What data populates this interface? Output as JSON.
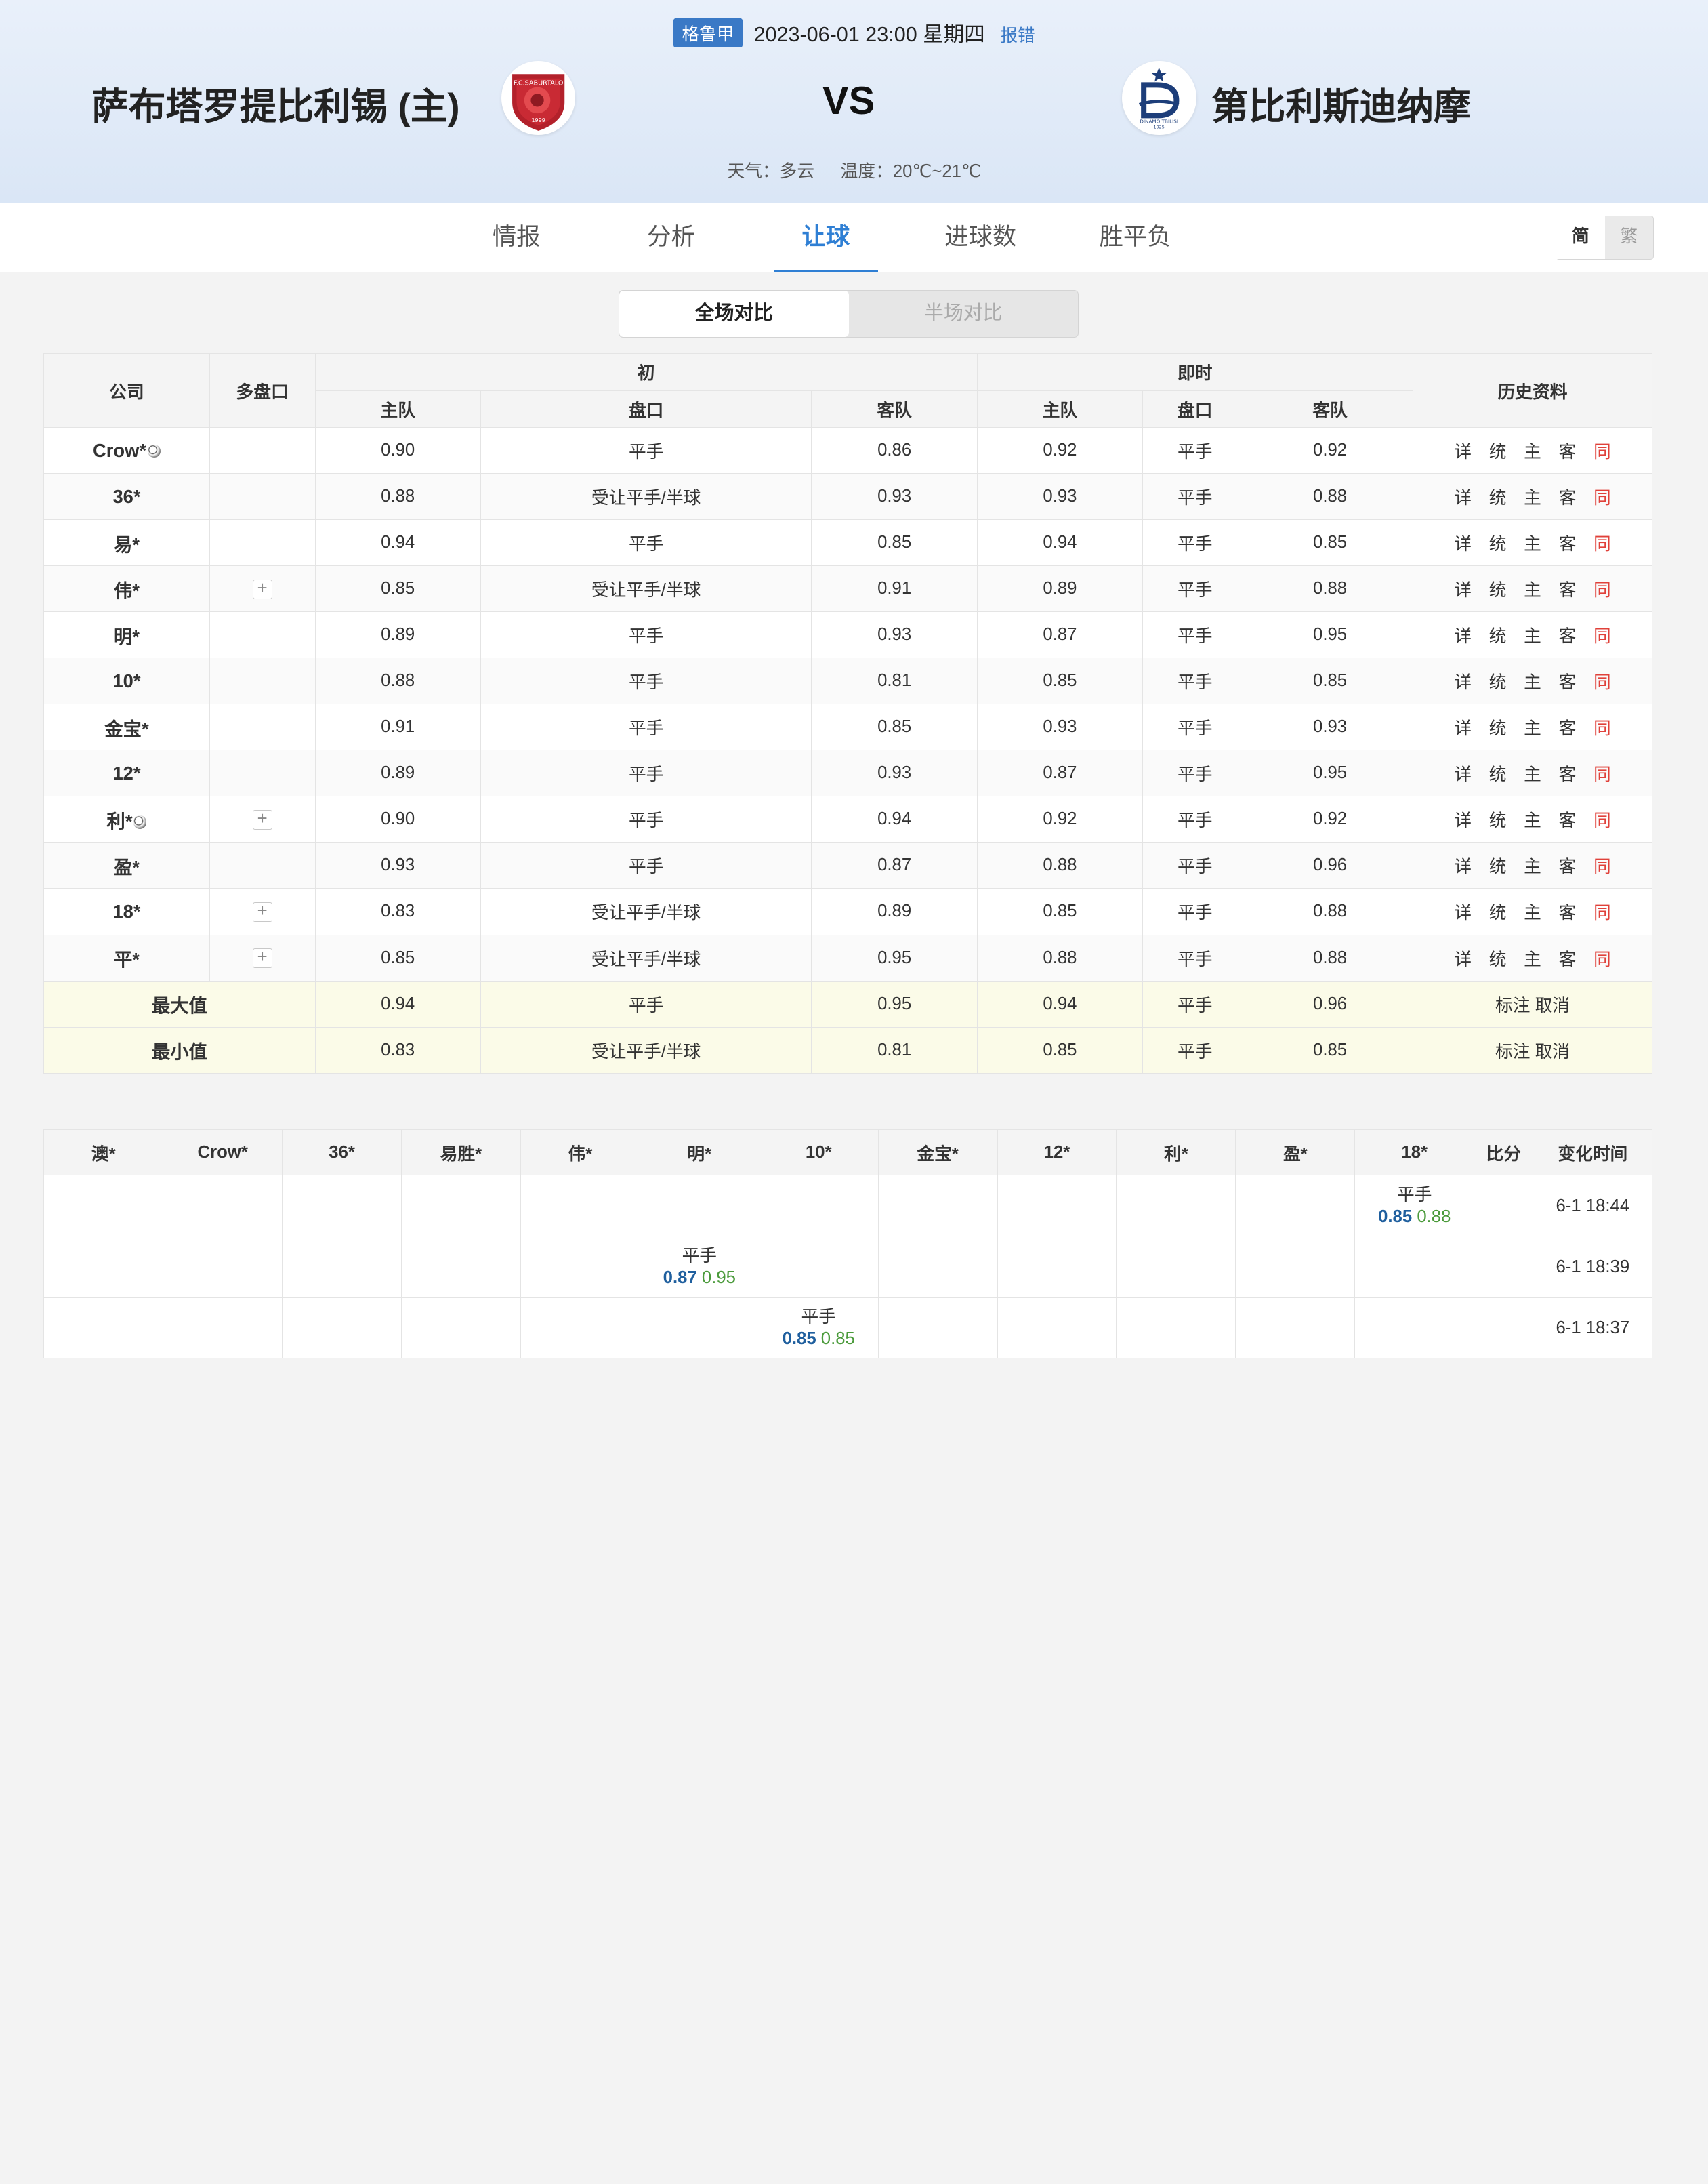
{
  "match": {
    "league": "格鲁甲",
    "datetime": "2023-06-01 23:00 星期四",
    "report": "报错",
    "home_team": "萨布塔罗提比利锡 (主)",
    "away_team": "第比利斯迪纳摩",
    "vs": "VS",
    "weather": "天气：多云",
    "temperature": "温度：20℃~21℃",
    "home_logo_text": "F.C.SABURTALO",
    "home_logo_year": "1999",
    "away_logo_text": "DINAMO TBILISI",
    "away_logo_year": "1925"
  },
  "tabs": [
    "情报",
    "分析",
    "让球",
    "进球数",
    "胜平负"
  ],
  "active_tab": "让球",
  "lang": {
    "simplified": "简",
    "traditional": "繁"
  },
  "toggle": {
    "full": "全场对比",
    "half": "半场对比"
  },
  "odds_table": {
    "headers": {
      "company": "公司",
      "multi": "多盘口",
      "initial": "初",
      "live": "即时",
      "history": "历史资料",
      "home": "主队",
      "handicap": "盘口",
      "away": "客队"
    },
    "history_links": [
      "详",
      "统",
      "主",
      "客",
      "同"
    ],
    "rows": [
      {
        "company": "Crow*",
        "ball": true,
        "multi": false,
        "i_home": "0.90",
        "i_hc": "平手",
        "i_away": "0.86",
        "l_home": "0.92",
        "l_hc": "平手",
        "l_away": "0.92"
      },
      {
        "company": "36*",
        "ball": false,
        "multi": false,
        "i_home": "0.88",
        "i_hc": "受让平手/半球",
        "i_away": "0.93",
        "l_home": "0.93",
        "l_hc": "平手",
        "l_away": "0.88"
      },
      {
        "company": "易*",
        "ball": false,
        "multi": false,
        "i_home": "0.94",
        "i_hc": "平手",
        "i_away": "0.85",
        "l_home": "0.94",
        "l_hc": "平手",
        "l_away": "0.85"
      },
      {
        "company": "伟*",
        "ball": false,
        "multi": true,
        "i_home": "0.85",
        "i_hc": "受让平手/半球",
        "i_away": "0.91",
        "l_home": "0.89",
        "l_hc": "平手",
        "l_away": "0.88"
      },
      {
        "company": "明*",
        "ball": false,
        "multi": false,
        "i_home": "0.89",
        "i_hc": "平手",
        "i_away": "0.93",
        "l_home": "0.87",
        "l_hc": "平手",
        "l_away": "0.95"
      },
      {
        "company": "10*",
        "ball": false,
        "multi": false,
        "i_home": "0.88",
        "i_hc": "平手",
        "i_away": "0.81",
        "l_home": "0.85",
        "l_hc": "平手",
        "l_away": "0.85"
      },
      {
        "company": "金宝*",
        "ball": false,
        "multi": false,
        "i_home": "0.91",
        "i_hc": "平手",
        "i_away": "0.85",
        "l_home": "0.93",
        "l_hc": "平手",
        "l_away": "0.93"
      },
      {
        "company": "12*",
        "ball": false,
        "multi": false,
        "i_home": "0.89",
        "i_hc": "平手",
        "i_away": "0.93",
        "l_home": "0.87",
        "l_hc": "平手",
        "l_away": "0.95"
      },
      {
        "company": "利*",
        "ball": true,
        "multi": true,
        "i_home": "0.90",
        "i_hc": "平手",
        "i_away": "0.94",
        "l_home": "0.92",
        "l_hc": "平手",
        "l_away": "0.92"
      },
      {
        "company": "盈*",
        "ball": false,
        "multi": false,
        "i_home": "0.93",
        "i_hc": "平手",
        "i_away": "0.87",
        "l_home": "0.88",
        "l_hc": "平手",
        "l_away": "0.96"
      },
      {
        "company": "18*",
        "ball": false,
        "multi": true,
        "i_home": "0.83",
        "i_hc": "受让平手/半球",
        "i_away": "0.89",
        "l_home": "0.85",
        "l_hc": "平手",
        "l_away": "0.88"
      },
      {
        "company": "平*",
        "ball": false,
        "multi": true,
        "i_home": "0.85",
        "i_hc": "受让平手/半球",
        "i_away": "0.95",
        "l_home": "0.88",
        "l_hc": "平手",
        "l_away": "0.88"
      }
    ],
    "summary": [
      {
        "label": "最大值",
        "i_home": "0.94",
        "i_hc": "平手",
        "i_away": "0.95",
        "l_home": "0.94",
        "l_hc": "平手",
        "l_away": "0.96",
        "action": "标注 取消"
      },
      {
        "label": "最小值",
        "i_home": "0.83",
        "i_hc": "受让平手/半球",
        "i_away": "0.81",
        "l_home": "0.85",
        "l_hc": "平手",
        "l_away": "0.85",
        "action": "标注 取消"
      }
    ]
  },
  "changes_table": {
    "headers": [
      "澳*",
      "Crow*",
      "36*",
      "易胜*",
      "伟*",
      "明*",
      "10*",
      "金宝*",
      "12*",
      "利*",
      "盈*",
      "18*",
      "比分",
      "变化时间"
    ],
    "rows": [
      {
        "col": 11,
        "handicap": "平手",
        "home": "0.85",
        "away": "0.88",
        "time": "6-1 18:44"
      },
      {
        "col": 5,
        "handicap": "平手",
        "home": "0.87",
        "away": "0.95",
        "time": "6-1 18:39"
      },
      {
        "col": 6,
        "handicap": "平手",
        "home": "0.85",
        "away": "0.85",
        "time": "6-1 18:37"
      }
    ]
  }
}
